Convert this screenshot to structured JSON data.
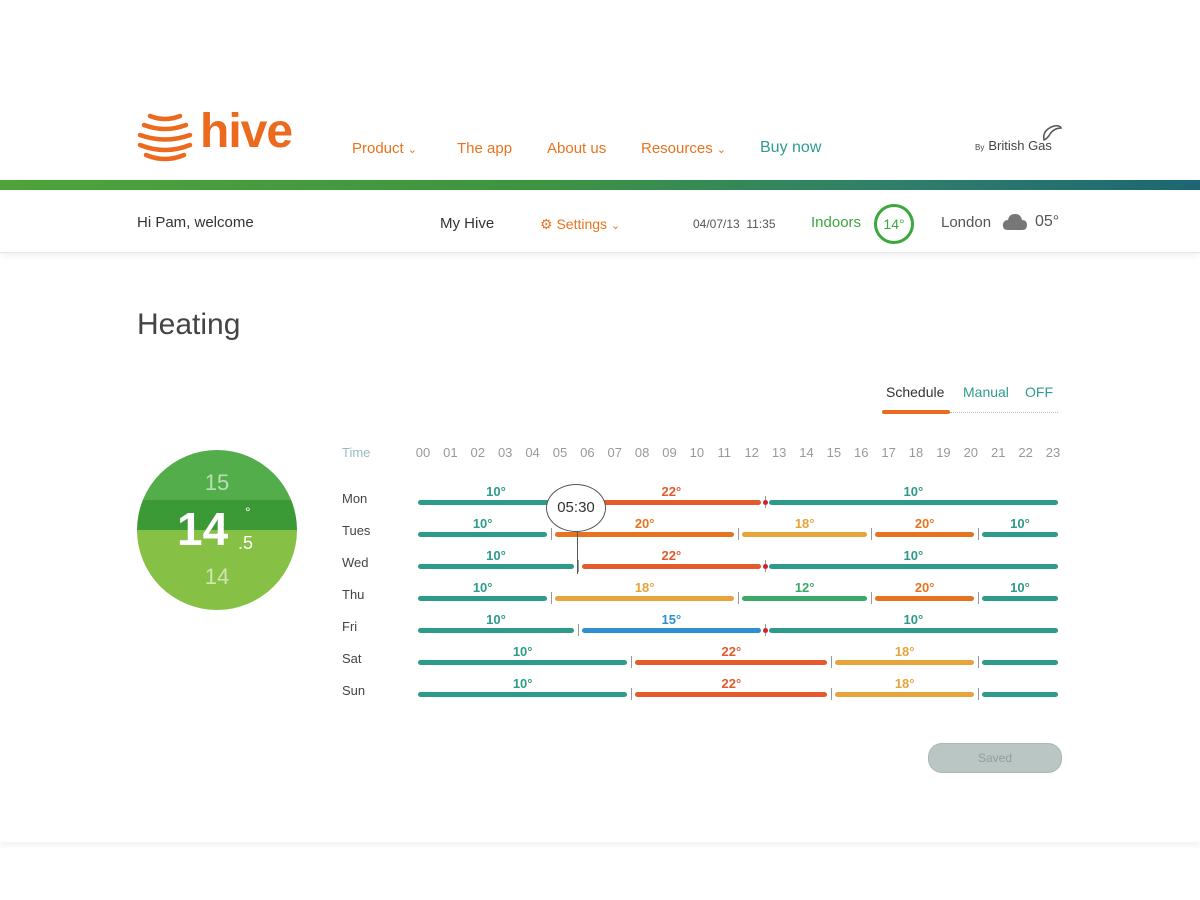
{
  "header": {
    "logo_text": "hive",
    "nav": [
      {
        "label": "Product",
        "has_dropdown": true
      },
      {
        "label": "The app",
        "has_dropdown": false
      },
      {
        "label": "About us",
        "has_dropdown": false
      },
      {
        "label": "Resources",
        "has_dropdown": true
      },
      {
        "label": "Buy now",
        "has_dropdown": false
      }
    ],
    "partner_prefix": "By",
    "partner": "British Gas"
  },
  "subbar": {
    "welcome": "Hi Pam, welcome",
    "my_hive": "My Hive",
    "settings": "Settings",
    "datetime": "04/07/13  11:35",
    "indoors_label": "Indoors",
    "indoors_temp": "14°",
    "location": "London",
    "outdoor_temp": "05°"
  },
  "page": {
    "title": "Heating",
    "modes": [
      "Schedule",
      "Manual",
      "OFF"
    ],
    "active_mode": "Schedule",
    "saved_label": "Saved"
  },
  "dial": {
    "above": "15",
    "current": "14",
    "decimal": ".5",
    "degree": "°",
    "below": "14"
  },
  "schedule": {
    "time_label": "Time",
    "hours": [
      "00",
      "01",
      "02",
      "03",
      "04",
      "05",
      "06",
      "07",
      "08",
      "09",
      "10",
      "11",
      "12",
      "13",
      "14",
      "15",
      "16",
      "17",
      "18",
      "19",
      "20",
      "21",
      "22",
      "23"
    ],
    "pin_time": "05:30",
    "colors": {
      "10": "#2e9a88",
      "12": "#3aa866",
      "15": "#2f8fd0",
      "18": "#e8a33a",
      "20": "#e8731f",
      "22": "#e35a2c"
    },
    "days": [
      {
        "day": "Mon",
        "segments": [
          {
            "start": 0,
            "end": 6,
            "temp": "10°"
          },
          {
            "start": 6,
            "end": 13,
            "temp": "22°"
          },
          {
            "start": 13,
            "end": 24,
            "temp": "10°"
          }
        ],
        "now_marker": true
      },
      {
        "day": "Tues",
        "segments": [
          {
            "start": 0,
            "end": 5,
            "temp": "10°"
          },
          {
            "start": 5,
            "end": 12,
            "temp": "20°"
          },
          {
            "start": 12,
            "end": 17,
            "temp": "18°"
          },
          {
            "start": 17,
            "end": 21,
            "temp": "20°"
          },
          {
            "start": 21,
            "end": 24,
            "temp": "10°"
          }
        ],
        "now_marker": false
      },
      {
        "day": "Wed",
        "segments": [
          {
            "start": 0,
            "end": 6,
            "temp": "10°"
          },
          {
            "start": 6,
            "end": 13,
            "temp": "22°"
          },
          {
            "start": 13,
            "end": 24,
            "temp": "10°"
          }
        ],
        "now_marker": true
      },
      {
        "day": "Thu",
        "segments": [
          {
            "start": 0,
            "end": 5,
            "temp": "10°"
          },
          {
            "start": 5,
            "end": 12,
            "temp": "18°"
          },
          {
            "start": 12,
            "end": 17,
            "temp": "12°"
          },
          {
            "start": 17,
            "end": 21,
            "temp": "20°"
          },
          {
            "start": 21,
            "end": 24,
            "temp": "10°"
          }
        ],
        "now_marker": false
      },
      {
        "day": "Fri",
        "segments": [
          {
            "start": 0,
            "end": 6,
            "temp": "10°"
          },
          {
            "start": 6,
            "end": 13,
            "temp": "15°"
          },
          {
            "start": 13,
            "end": 24,
            "temp": "10°"
          }
        ],
        "now_marker": true
      },
      {
        "day": "Sat",
        "segments": [
          {
            "start": 0,
            "end": 8,
            "temp": "10°"
          },
          {
            "start": 8,
            "end": 15.5,
            "temp": "22°"
          },
          {
            "start": 15.5,
            "end": 21,
            "temp": "18°"
          },
          {
            "start": 21,
            "end": 24,
            "temp": ""
          }
        ],
        "now_marker": false
      },
      {
        "day": "Sun",
        "segments": [
          {
            "start": 0,
            "end": 8,
            "temp": "10°"
          },
          {
            "start": 8,
            "end": 15.5,
            "temp": "22°"
          },
          {
            "start": 15.5,
            "end": 21,
            "temp": "18°"
          },
          {
            "start": 21,
            "end": 24,
            "temp": ""
          }
        ],
        "now_marker": false
      }
    ]
  }
}
